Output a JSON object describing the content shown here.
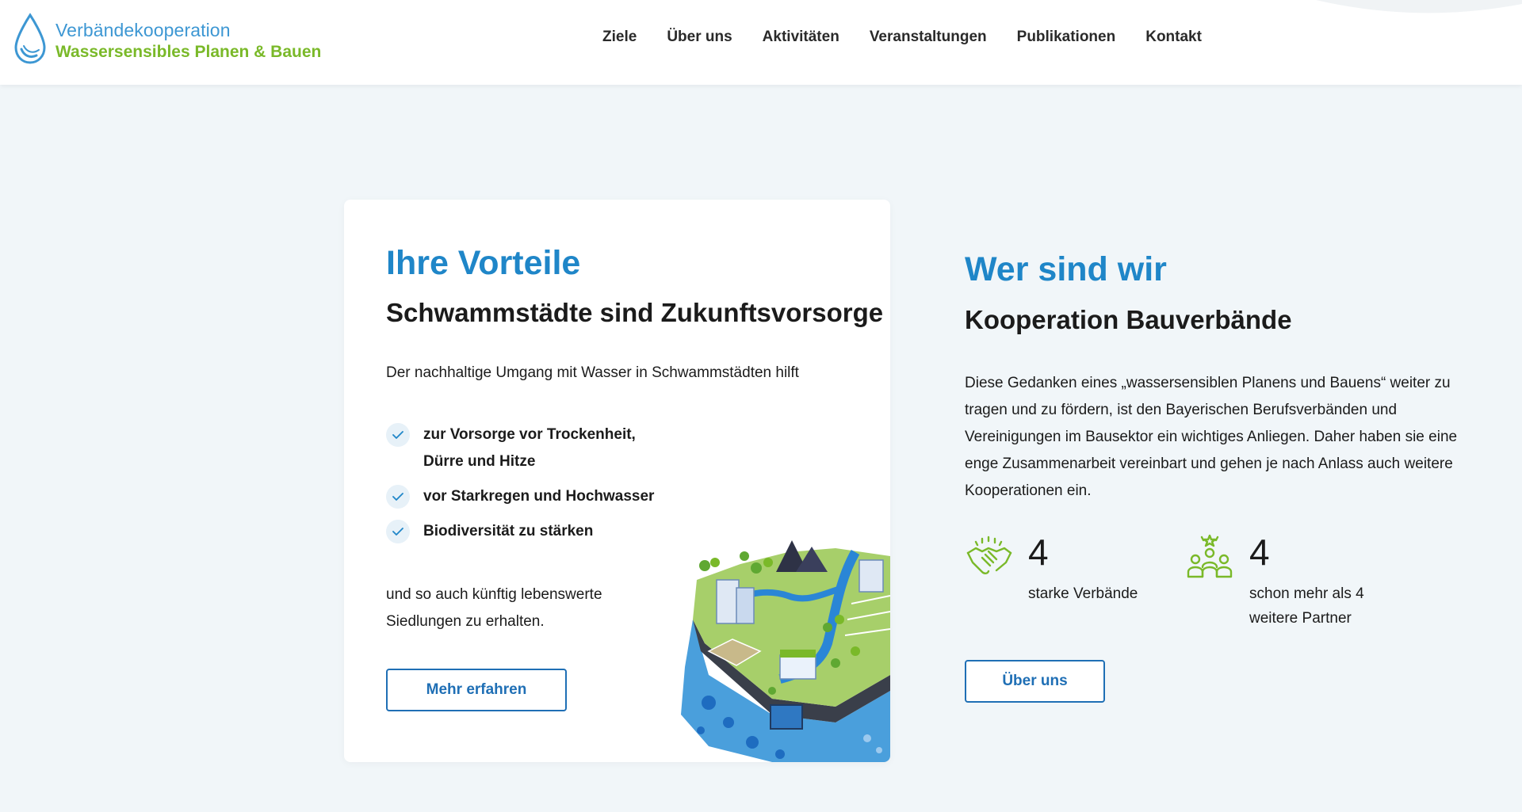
{
  "header": {
    "logo": {
      "line1": "Verbändekooperation",
      "line2": "Wassersensibles Planen & Bauen",
      "icon": "water-drop-icon"
    },
    "nav": [
      {
        "label": "Ziele"
      },
      {
        "label": "Über uns"
      },
      {
        "label": "Aktivitäten"
      },
      {
        "label": "Veranstaltungen"
      },
      {
        "label": "Publikationen"
      },
      {
        "label": "Kontakt"
      }
    ]
  },
  "benefits_card": {
    "title": "Ihre Vorteile",
    "subtitle": "Schwammstädte sind Zukunftsvorsorge",
    "intro": "Der nachhaltige Umgang mit Wasser in Schwammstädten hilft",
    "items": [
      {
        "text": "zur Vorsorge vor Trockenheit, Dürre und Hitze",
        "icon": "check-icon"
      },
      {
        "text": "vor Starkregen und Hochwasser",
        "icon": "check-icon"
      },
      {
        "text": "Biodiversität zu stärken",
        "icon": "check-icon"
      }
    ],
    "outro": "und so auch künftig lebenswerte Siedlungen zu erhalten.",
    "button_label": "Mehr erfahren",
    "illustration": "sponge-city-illustration"
  },
  "about": {
    "title": "Wer sind wir",
    "subtitle": "Kooperation Bauverbände",
    "text": "Diese Gedanken eines „wassersensiblen Planens und Bauens“ weiter zu tragen und zu fördern, ist den Bayerischen Berufsverbänden und Vereinigungen im Bausektor ein wichtiges Anliegen. Daher haben sie eine enge Zusammenarbeit vereinbart und gehen je nach Anlass auch weitere Kooperationen ein.",
    "stats": [
      {
        "number": "4",
        "label": "starke Verbände",
        "icon": "handshake-icon"
      },
      {
        "number": "4",
        "label": "schon mehr als 4 weitere Partner",
        "icon": "group-icon"
      }
    ],
    "button_label": "Über uns"
  },
  "colors": {
    "accent_blue": "#1f86c8",
    "button_blue": "#1f6fb5",
    "logo_green": "#7ab929",
    "background": "#f1f6f9"
  }
}
